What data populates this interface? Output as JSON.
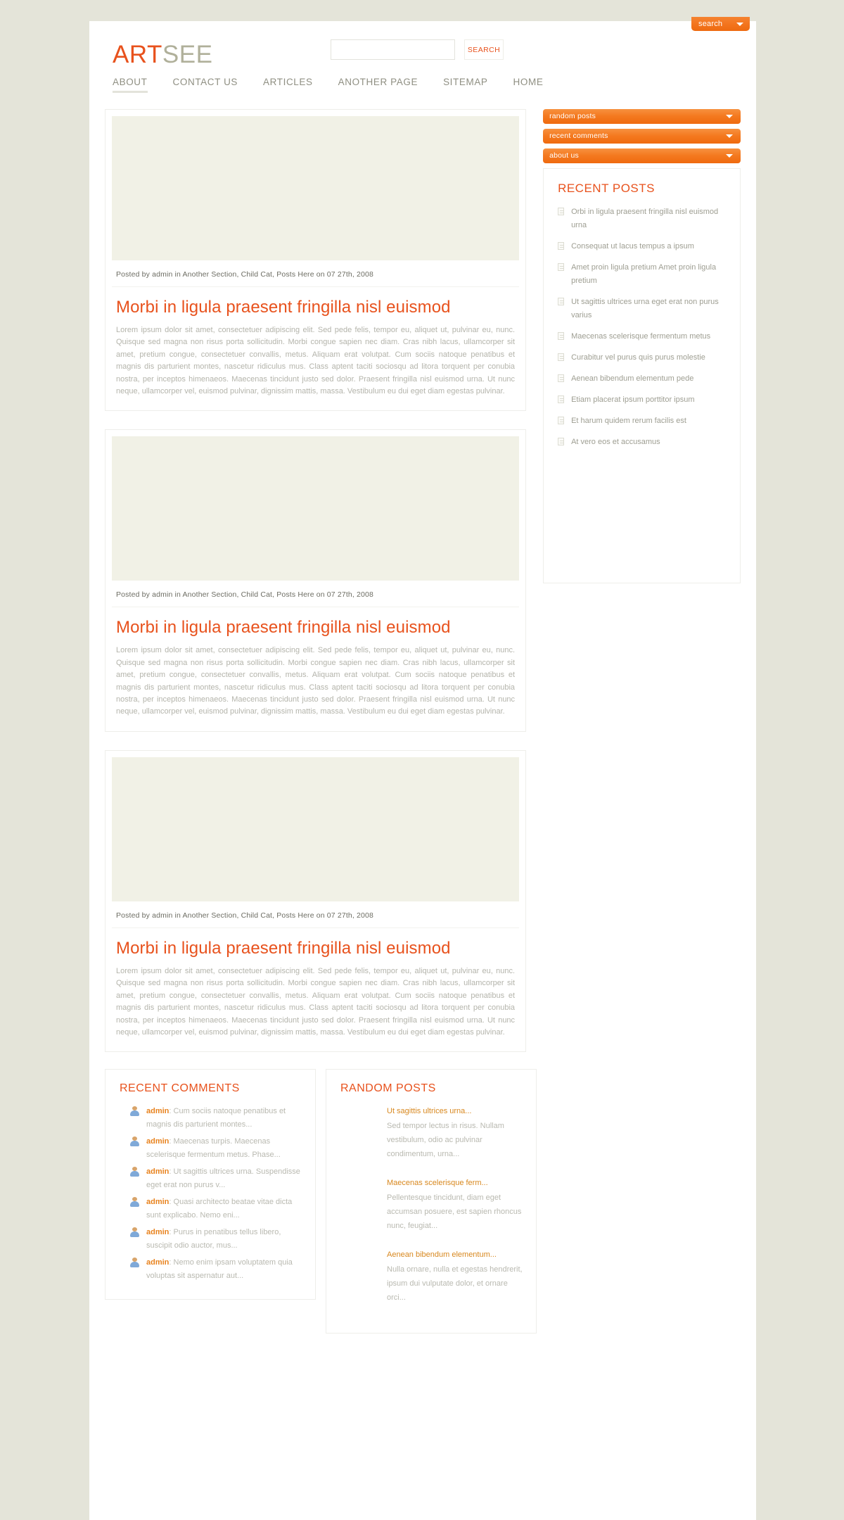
{
  "top_tab": {
    "label": "search",
    "icon": "chevron-down-icon"
  },
  "header": {
    "logo_first": "ART",
    "logo_second": "SEE",
    "search": {
      "value": "",
      "placeholder": "",
      "button_label": "SEARCH",
      "icon": "search-icon"
    }
  },
  "nav": {
    "items": [
      {
        "label": "ABOUT",
        "active": true
      },
      {
        "label": "CONTACT US",
        "active": false
      },
      {
        "label": "ARTICLES",
        "active": false
      },
      {
        "label": "ANOTHER PAGE",
        "active": false
      },
      {
        "label": "SITEMAP",
        "active": false
      },
      {
        "label": "HOME",
        "active": false
      }
    ]
  },
  "posts": [
    {
      "meta": "Posted by admin in Another Section, Child Cat, Posts Here on 07 27th, 2008",
      "title": "Morbi in ligula praesent fringilla nisl euismod",
      "body": "Lorem ipsum dolor sit amet, consectetuer adipiscing elit. Sed pede felis, tempor eu, aliquet ut, pulvinar eu, nunc. Quisque sed magna non risus porta sollicitudin. Morbi congue sapien nec diam. Cras nibh lacus, ullamcorper sit amet, pretium congue, consectetuer convallis, metus. Aliquam erat volutpat. Cum sociis natoque penatibus et magnis dis parturient montes, nascetur ridiculus mus. Class aptent taciti sociosqu ad litora torquent per conubia nostra, per inceptos himenaeos. Maecenas tincidunt justo sed dolor. Praesent fringilla nisl euismod urna. Ut nunc neque, ullamcorper vel, euismod pulvinar, dignissim mattis, massa. Vestibulum eu dui eget diam egestas pulvinar."
    },
    {
      "meta": "Posted by admin in Another Section, Child Cat, Posts Here on 07 27th, 2008",
      "title": "Morbi in ligula praesent fringilla nisl euismod",
      "body": "Lorem ipsum dolor sit amet, consectetuer adipiscing elit. Sed pede felis, tempor eu, aliquet ut, pulvinar eu, nunc. Quisque sed magna non risus porta sollicitudin. Morbi congue sapien nec diam. Cras nibh lacus, ullamcorper sit amet, pretium congue, consectetuer convallis, metus. Aliquam erat volutpat. Cum sociis natoque penatibus et magnis dis parturient montes, nascetur ridiculus mus. Class aptent taciti sociosqu ad litora torquent per conubia nostra, per inceptos himenaeos. Maecenas tincidunt justo sed dolor. Praesent fringilla nisl euismod urna. Ut nunc neque, ullamcorper vel, euismod pulvinar, dignissim mattis, massa. Vestibulum eu dui eget diam egestas pulvinar."
    },
    {
      "meta": "Posted by admin in Another Section, Child Cat, Posts Here on 07 27th, 2008",
      "title": "Morbi in ligula praesent fringilla nisl euismod",
      "body": "Lorem ipsum dolor sit amet, consectetuer adipiscing elit. Sed pede felis, tempor eu, aliquet ut, pulvinar eu, nunc. Quisque sed magna non risus porta sollicitudin. Morbi congue sapien nec diam. Cras nibh lacus, ullamcorper sit amet, pretium congue, consectetuer convallis, metus. Aliquam erat volutpat. Cum sociis natoque penatibus et magnis dis parturient montes, nascetur ridiculus mus. Class aptent taciti sociosqu ad litora torquent per conubia nostra, per inceptos himenaeos. Maecenas tincidunt justo sed dolor. Praesent fringilla nisl euismod urna. Ut nunc neque, ullamcorper vel, euismod pulvinar, dignissim mattis, massa. Vestibulum eu dui eget diam egestas pulvinar."
    }
  ],
  "sidebar": {
    "accordion": [
      {
        "label": "random posts",
        "icon": "chevron-down-icon"
      },
      {
        "label": "recent comments",
        "icon": "chevron-down-icon"
      },
      {
        "label": "about us",
        "icon": "chevron-down-icon"
      }
    ],
    "recent_posts": {
      "title": "RECENT POSTS",
      "items": [
        "Orbi in ligula praesent fringilla nisl euismod urna",
        "Consequat ut lacus tempus a ipsum",
        "Amet proin ligula pretium Amet proin ligula pretium",
        "Ut sagittis ultrices urna eget erat non purus varius",
        "Maecenas scelerisque fermentum metus",
        "Curabitur vel purus quis purus molestie",
        "Aenean bibendum elementum pede",
        "Etiam placerat ipsum porttitor ipsum",
        "Et harum quidem rerum facilis est",
        "At vero eos et accusamus"
      ]
    }
  },
  "bottom": {
    "recent_comments": {
      "title": "RECENT COMMENTS",
      "items": [
        {
          "author": "admin",
          "text": ": Cum sociis natoque penatibus et magnis dis parturient montes..."
        },
        {
          "author": "admin",
          "text": ": Maecenas turpis. Maecenas scelerisque fermentum metus. Phase..."
        },
        {
          "author": "admin",
          "text": ": Ut sagittis ultrices urna. Suspendisse eget erat non purus v..."
        },
        {
          "author": "admin",
          "text": ": Quasi architecto beatae vitae dicta sunt explicabo. Nemo eni..."
        },
        {
          "author": "admin",
          "text": ": Purus in penatibus tellus libero, suscipit odio auctor, mus..."
        },
        {
          "author": "admin",
          "text": ": Nemo enim ipsam voluptatem quia voluptas sit aspernatur aut..."
        }
      ]
    },
    "random_posts": {
      "title": "RANDOM POSTS",
      "items": [
        {
          "title": "Ut sagittis ultrices urna...",
          "excerpt": "Sed tempor lectus in risus. Nullam vestibulum, odio ac pulvinar condimentum, urna..."
        },
        {
          "title": "Maecenas scelerisque ferm...",
          "excerpt": "Pellentesque tincidunt, diam eget accumsan posuere, est sapien rhoncus nunc, feugiat..."
        },
        {
          "title": "Aenean bibendum elementum...",
          "excerpt": "Nulla ornare, nulla et egestas hendrerit, ipsum dui vulputate dolor, et ornare orci..."
        }
      ]
    }
  },
  "colors": {
    "accent": "#e8521d",
    "orange_btn": "#f4791f",
    "page_bg": "#e4e4d9",
    "thumb_bg": "#f1f1e6",
    "muted_text": "#b4b4ab",
    "link_gold": "#d8881f"
  }
}
